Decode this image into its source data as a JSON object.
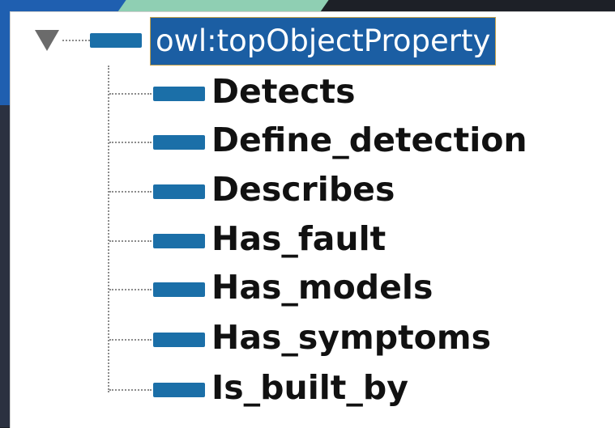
{
  "colors": {
    "property_icon": "#1b6fa8",
    "selection_background": "#1b5ea3",
    "selection_border": "#c6a24b",
    "panel_background": "#ffffff",
    "tree_lines": "#8c8c8c"
  },
  "tree": {
    "root": {
      "label": "owl:topObjectProperty",
      "expanded": true,
      "selected": true,
      "toggle_icon": "triangle-down-icon",
      "icon": "object-property-icon"
    },
    "children": [
      {
        "label": "Detects",
        "icon": "object-property-icon"
      },
      {
        "label": "Define_detection",
        "icon": "object-property-icon"
      },
      {
        "label": "Describes",
        "icon": "object-property-icon"
      },
      {
        "label": "Has_fault",
        "icon": "object-property-icon"
      },
      {
        "label": "Has_models",
        "icon": "object-property-icon"
      },
      {
        "label": "Has_symptoms",
        "icon": "object-property-icon"
      },
      {
        "label": "Is_built_by",
        "icon": "object-property-icon"
      }
    ]
  }
}
